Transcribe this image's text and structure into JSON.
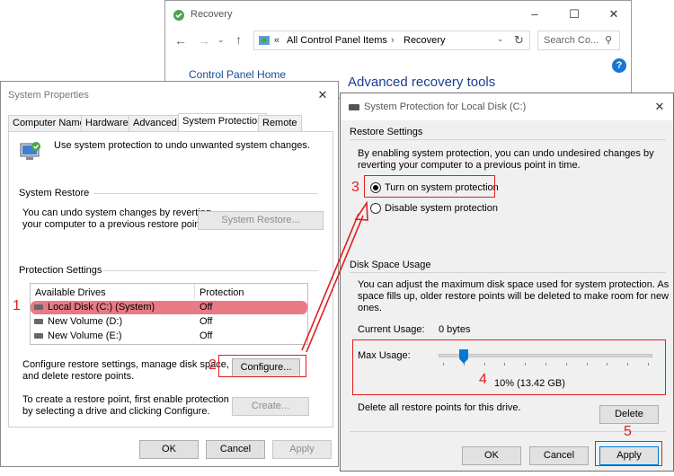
{
  "recovery": {
    "title": "Recovery",
    "breadcrumb_root": "All Control Panel Items",
    "breadcrumb_current": "Recovery",
    "breadcrumb_sep": "›",
    "breadcrumb_prefix": "«",
    "search_placeholder": "Search Co...",
    "sidebar_home": "Control Panel Home",
    "heading": "Advanced recovery tools"
  },
  "sysprops": {
    "title": "System Properties",
    "tabs": [
      "Computer Name",
      "Hardware",
      "Advanced",
      "System Protection",
      "Remote"
    ],
    "active_tab": "System Protection",
    "intro": "Use system protection to undo unwanted system changes.",
    "restore_header": "System Restore",
    "restore_desc_1": "You can undo system changes by reverting",
    "restore_desc_2": "your computer to a previous restore point.",
    "restore_button": "System Restore...",
    "protection_header": "Protection Settings",
    "col_drives": "Available Drives",
    "col_protection": "Protection",
    "drives": [
      {
        "name": "Local Disk (C:) (System)",
        "protection": "Off"
      },
      {
        "name": "New Volume (D:)",
        "protection": "Off"
      },
      {
        "name": "New Volume (E:)",
        "protection": "Off"
      }
    ],
    "configure_desc_1": "Configure restore settings, manage disk space,",
    "configure_desc_2": "and delete restore points.",
    "configure_button": "Configure...",
    "create_desc_1": "To create a restore point, first enable protection",
    "create_desc_2": "by selecting a drive and clicking Configure.",
    "create_button": "Create...",
    "ok": "OK",
    "cancel": "Cancel",
    "apply": "Apply"
  },
  "sysprot": {
    "title": "System Protection for Local Disk (C:)",
    "restore_settings_header": "Restore Settings",
    "restore_settings_desc_1": "By enabling system protection, you can undo undesired changes by",
    "restore_settings_desc_2": "reverting your computer to a previous point in time.",
    "option_on": "Turn on system protection",
    "option_off": "Disable system protection",
    "selected_option": "on",
    "disk_header": "Disk Space Usage",
    "disk_desc_1": "You can adjust the maximum disk space used for system protection. As",
    "disk_desc_2": "space fills up, older restore points will be deleted to make room for new",
    "disk_desc_3": "ones.",
    "current_usage_label": "Current Usage:",
    "current_usage_value": "0 bytes",
    "max_usage_label": "Max Usage:",
    "max_usage_value": "10% (13.42 GB)",
    "max_usage_fraction": 0.1,
    "delete_desc": "Delete all restore points for this drive.",
    "delete_button": "Delete",
    "ok": "OK",
    "cancel": "Cancel",
    "apply": "Apply"
  },
  "annotations": {
    "steps": [
      "1",
      "2",
      "3",
      "4",
      "5"
    ],
    "color": "#e02020"
  },
  "colors": {
    "accent": "#0078d7",
    "highlight_row": "#e87a86",
    "link": "#1a4d8f"
  }
}
